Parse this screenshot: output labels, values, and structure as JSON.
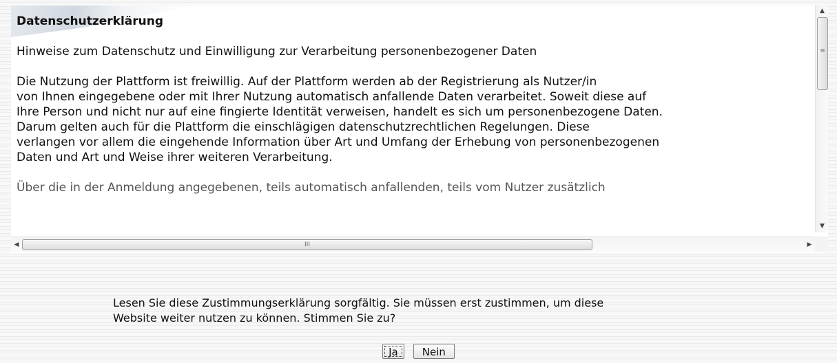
{
  "document": {
    "title": "Datenschutzerklärung",
    "subtitle": "Hinweise zum Datenschutz und Einwilligung zur Verarbeitung personenbezogener Daten",
    "paragraph1_lines": [
      "Die Nutzung der Plattform ist freiwillig. Auf der Plattform werden ab der Registrierung als Nutzer/in",
      "von Ihnen eingegebene oder mit Ihrer Nutzung automatisch anfallende Daten verarbeitet. Soweit diese auf",
      "Ihre Person und nicht nur auf eine fingierte Identität verweisen, handelt es sich um personenbezogene Daten.",
      "Darum gelten auch für die Plattform die einschlägigen datenschutzrechtlichen Regelungen. Diese",
      "verlangen vor allem die eingehende Information über Art und Umfang der Erhebung von personenbezogenen",
      "Daten und Art und Weise ihrer weiteren Verarbeitung."
    ],
    "cutoff_line": "Über die in der Anmeldung angegebenen, teils automatisch anfallenden, teils vom Nutzer zusätzlich"
  },
  "scrollbars": {
    "vertical_up_icon": "arrow-up-icon",
    "vertical_down_icon": "arrow-down-icon",
    "vertical_grip": "≡",
    "horizontal_grip": "III",
    "vertical_up": "▲",
    "vertical_down": "▼",
    "horizontal_left": "◀",
    "horizontal_right": "▶"
  },
  "prompt": {
    "line1": "Lesen Sie diese Zustimmungserklärung sorgfältig. Sie müssen erst zustimmen, um diese",
    "line2": "Website weiter nutzen zu können. Stimmen Sie zu?"
  },
  "buttons": {
    "yes_label": "Ja",
    "no_label": "Nein"
  }
}
